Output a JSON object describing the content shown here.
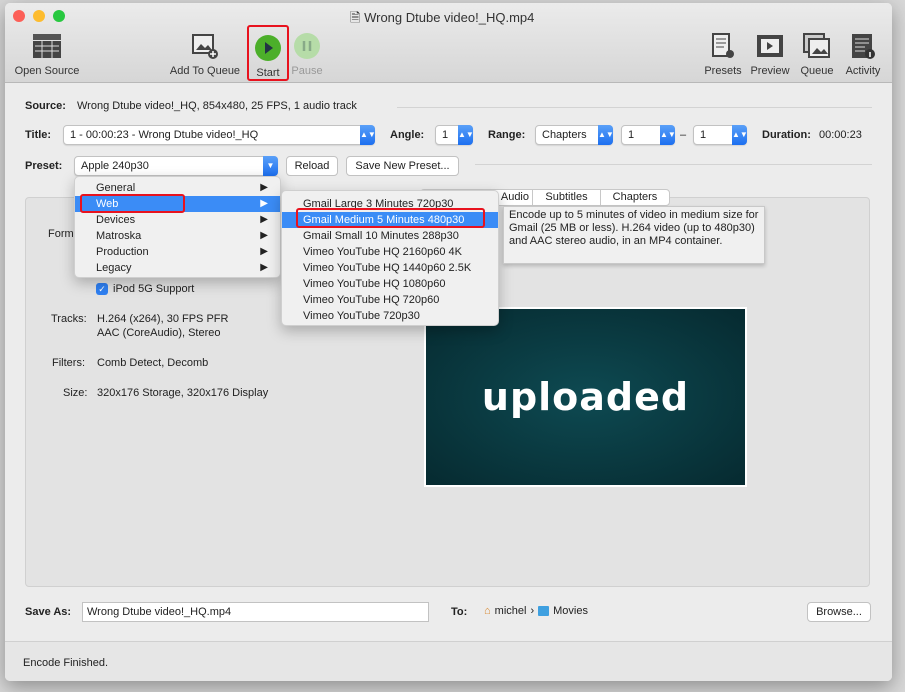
{
  "window": {
    "title": "Wrong Dtube video!_HQ.mp4"
  },
  "toolbar": {
    "open_source": "Open Source",
    "add_to_queue": "Add To Queue",
    "start": "Start",
    "pause": "Pause",
    "presets": "Presets",
    "preview": "Preview",
    "queue": "Queue",
    "activity": "Activity"
  },
  "source": {
    "label": "Source:",
    "value": "Wrong Dtube video!_HQ, 854x480, 25 FPS, 1 audio track"
  },
  "title_row": {
    "label": "Title:",
    "value": "1 - 00:00:23 - Wrong Dtube video!_HQ",
    "angle_label": "Angle:",
    "angle": "1",
    "range_label": "Range:",
    "range": "Chapters",
    "range_start": "1",
    "range_sep": "–",
    "range_end": "1",
    "duration_label": "Duration:",
    "duration": "00:00:23"
  },
  "preset": {
    "label": "Preset:",
    "value": "Apple 240p30",
    "reload": "Reload",
    "save_new": "Save New Preset..."
  },
  "tabs": [
    "Audio",
    "Subtitles",
    "Chapters"
  ],
  "summary": {
    "format_label": "Format:",
    "ipod_label": "iPod 5G Support",
    "ipod_checked": true,
    "tracks_label": "Tracks:",
    "tracks": [
      "H.264 (x264), 30 FPS PFR",
      "AAC (CoreAudio), Stereo"
    ],
    "filters_label": "Filters:",
    "filters": "Comb Detect, Decomb",
    "size_label": "Size:",
    "size": "320x176 Storage, 320x176 Display",
    "preview_text": "uploaded"
  },
  "preset_menu": {
    "categories": [
      "General",
      "Web",
      "Devices",
      "Matroska",
      "Production",
      "Legacy"
    ],
    "selected": "Web"
  },
  "web_submenu": {
    "items": [
      "Gmail Large 3 Minutes 720p30",
      "Gmail Medium 5 Minutes 480p30",
      "Gmail Small 10 Minutes 288p30",
      "Vimeo YouTube HQ 2160p60 4K",
      "Vimeo YouTube HQ 1440p60 2.5K",
      "Vimeo YouTube HQ 1080p60",
      "Vimeo YouTube HQ 720p60",
      "Vimeo YouTube 720p30"
    ],
    "selected": "Gmail Medium 5 Minutes 480p30"
  },
  "tooltip": "Encode up to 5 minutes of video in medium size for Gmail (25 MB or less). H.264 video (up to 480p30) and AAC stereo audio, in an MP4 container.",
  "save": {
    "label": "Save As:",
    "value": "Wrong Dtube video!_HQ.mp4",
    "to_label": "To:",
    "path": [
      "michel",
      "Movies"
    ],
    "browse": "Browse..."
  },
  "status": "Encode Finished.",
  "colors": {
    "accent": "#3b8cf6",
    "highlight": "#e8121e",
    "start": "#4caf2a"
  }
}
